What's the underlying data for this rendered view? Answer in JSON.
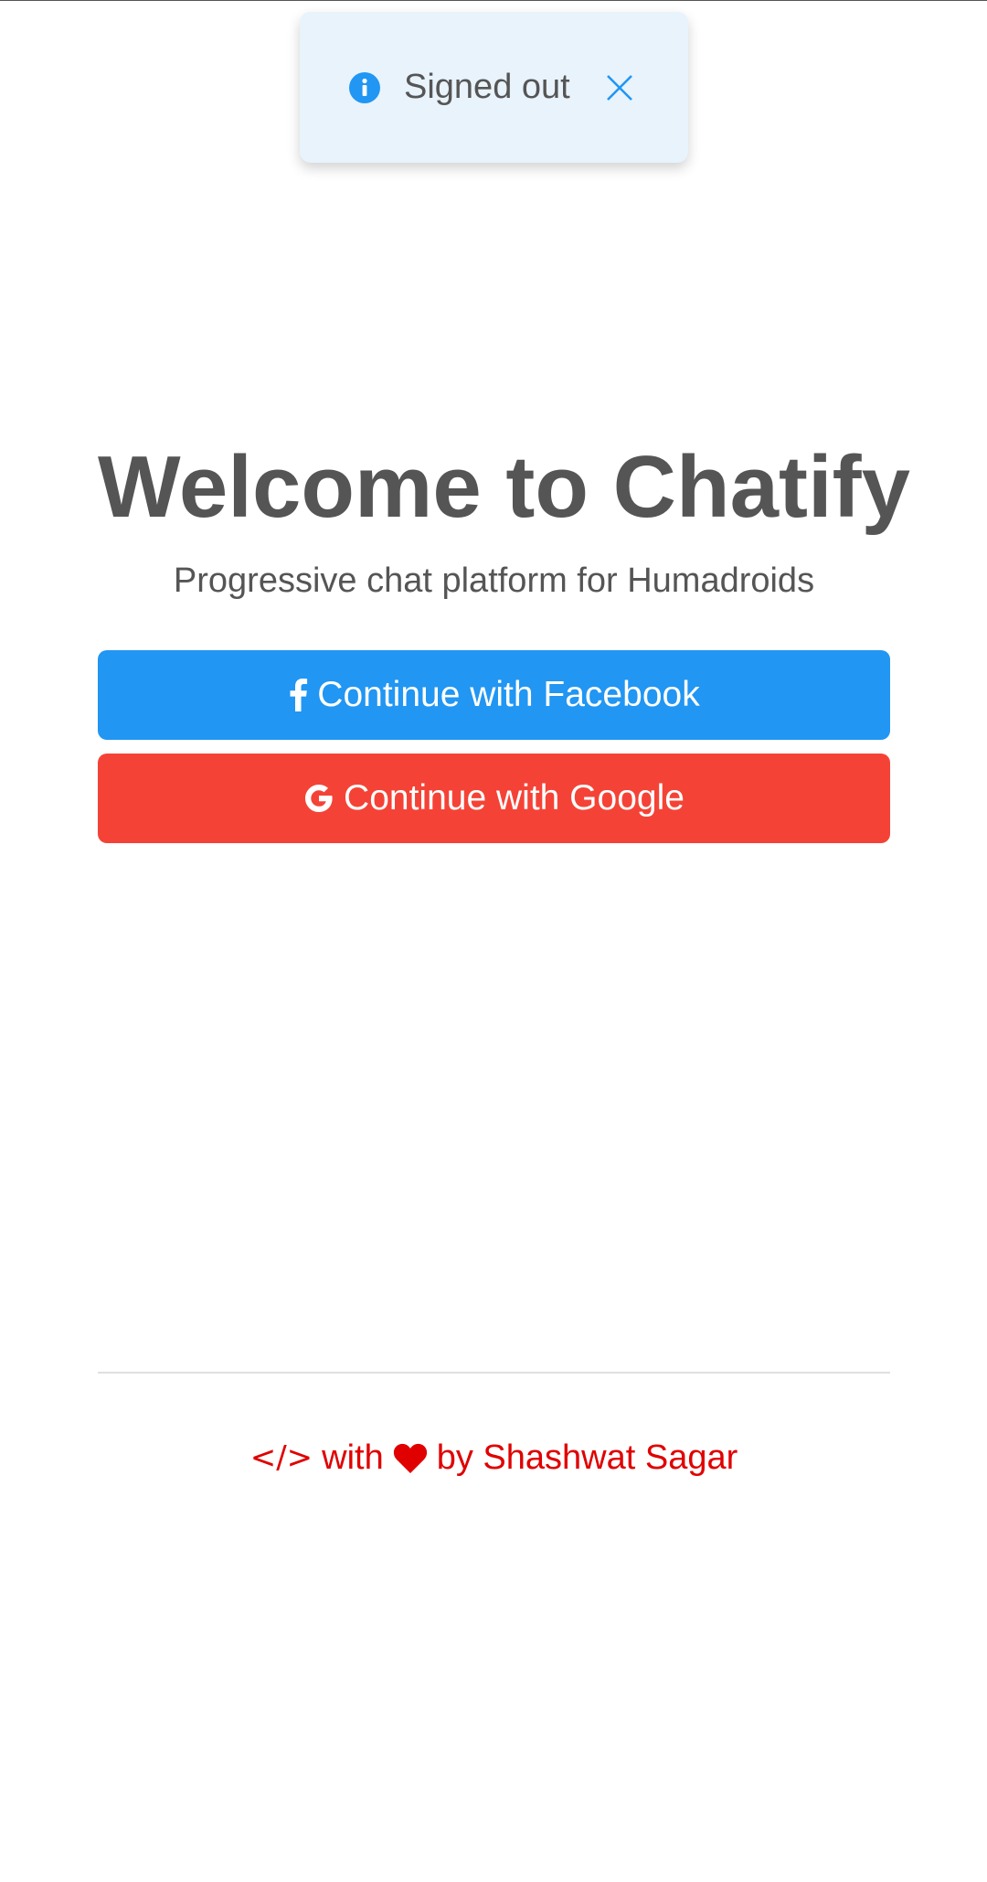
{
  "toast": {
    "icon": "info-icon",
    "message": "Signed out",
    "close_icon": "close-icon",
    "background": "#e8f3fc",
    "icon_color": "#2196f3"
  },
  "main": {
    "title": "Welcome to Chatify",
    "subtitle": "Progressive chat platform for Humadroids",
    "buttons": {
      "facebook": {
        "icon": "facebook-icon",
        "label": "Continue with Facebook",
        "color": "#2196f3"
      },
      "google": {
        "icon": "google-icon",
        "label": "Continue with Google",
        "color": "#f44336"
      }
    }
  },
  "footer": {
    "code_symbol": "</>",
    "with_text": "with",
    "heart_icon": "heart-icon",
    "by_text": "by Shashwat Sagar",
    "color": "#e00000"
  }
}
